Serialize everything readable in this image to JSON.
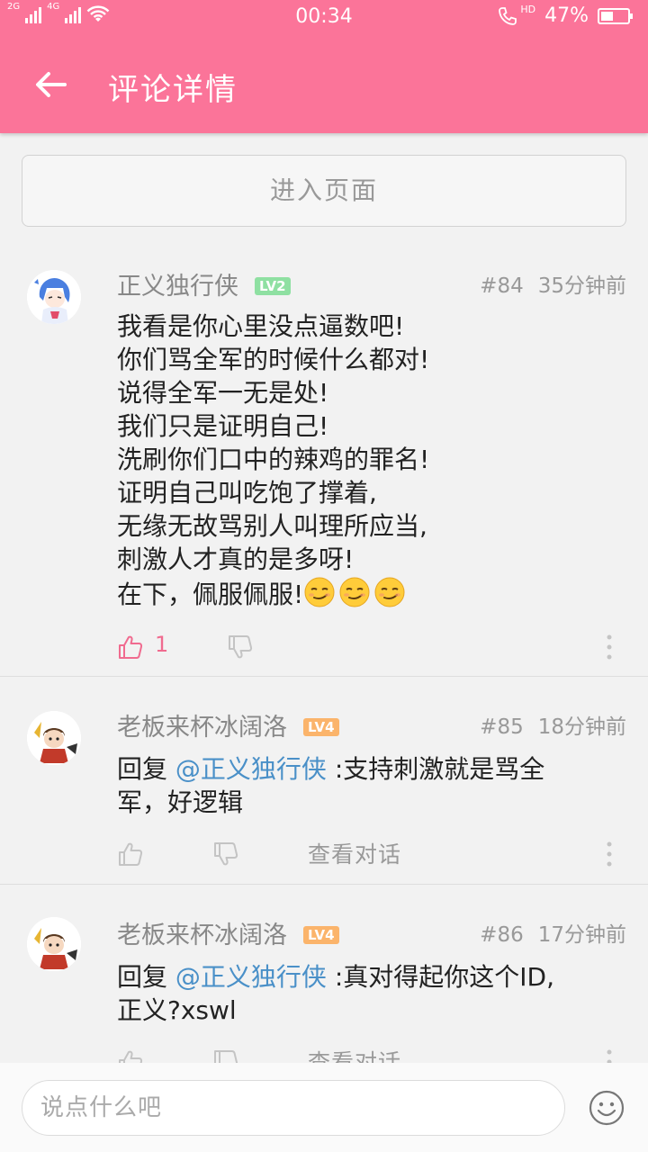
{
  "status_bar": {
    "network_1": "2G",
    "network_2": "4G",
    "time": "00:34",
    "hd": "HD",
    "battery_percent": "47%",
    "battery_level": 0.47
  },
  "app_bar": {
    "title": "评论详情",
    "back_icon": "arrow-left-icon"
  },
  "enter_page_label": "进入页面",
  "colors": {
    "primary": "#fb7499",
    "mention": "#4a90c8",
    "lv2": "#8fe0a2",
    "lv4": "#fbb46b"
  },
  "comments": [
    {
      "username": "正义独行侠",
      "level": "LV2",
      "floor": "#84",
      "time": "35分钟前",
      "lines": [
        "我看是你心里没点逼数吧!",
        "你们骂全军的时候什么都对!",
        "说得全军一无是处!",
        "我们只是证明自己!",
        "洗刷你们口中的辣鸡的罪名!",
        "证明自己叫吃饱了撑着,",
        "无缘无故骂别人叫理所应当,",
        "刺激人才真的是多呀!",
        "在下，佩服佩服!"
      ],
      "emoji_count": 3,
      "emoji_icon": "smirk-emoji-icon",
      "like_count": "1"
    },
    {
      "username": "老板来杯冰阔洛",
      "level": "LV4",
      "floor": "#85",
      "time": "18分钟前",
      "reply_prefix": "回复 ",
      "mention": "@正义独行侠",
      "line1_rest": " :支持刺激就是骂全",
      "line2": "军，好逻辑",
      "view_conversation": "查看对话"
    },
    {
      "username": "老板来杯冰阔洛",
      "level": "LV4",
      "floor": "#86",
      "time": "17分钟前",
      "reply_prefix": "回复 ",
      "mention": "@正义独行侠",
      "line1_rest": " :真对得起你这个ID,",
      "line2": "正义?xswl",
      "view_conversation": "查看对话"
    }
  ],
  "input_placeholder": "说点什么吧",
  "emoji_button_icon": "smile-face-icon"
}
